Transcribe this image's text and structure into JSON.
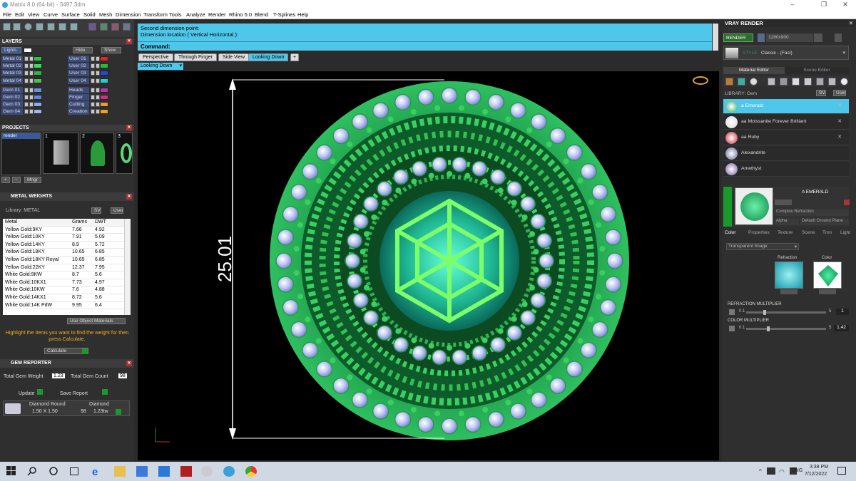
{
  "window": {
    "title": "Matrix 8.0 (64-bit) - 3497.3dm",
    "min": "–",
    "max": "❐",
    "close": "✕"
  },
  "menu": [
    "File",
    "Edit",
    "View",
    "Curve",
    "Surface",
    "Solid",
    "Mesh",
    "Dimension",
    "Transform",
    "Tools",
    "Analyze",
    "Render",
    "Rhino 5.0",
    "Blend",
    "T-Splines",
    "Help"
  ],
  "layers": {
    "title": "LAYERS",
    "lights_label": "Lights",
    "hide_label": "Hide",
    "show_label": "Show",
    "left": [
      {
        "name": "Metal 01",
        "color": "#2dc43a"
      },
      {
        "name": "Metal 02",
        "color": "#3fd860"
      },
      {
        "name": "Metal 03",
        "color": "#39b04a"
      },
      {
        "name": "Metal 04",
        "color": "#50c050"
      },
      {
        "name": "Gem 01",
        "color": "#6c8fe8"
      },
      {
        "name": "Gem 02",
        "color": "#5a8ae0"
      },
      {
        "name": "Gem 03",
        "color": "#88aaf0"
      },
      {
        "name": "Gem 04",
        "color": "#9ab8ee"
      }
    ],
    "right": [
      {
        "name": "User 01",
        "color": "#e0242c"
      },
      {
        "name": "User 02",
        "color": "#22c030"
      },
      {
        "name": "User 03",
        "color": "#2448e8"
      },
      {
        "name": "User 04",
        "color": "#20d0d8"
      },
      {
        "name": "Heads",
        "color": "#b03aa8"
      },
      {
        "name": "Finger",
        "color": "#d82a8a"
      },
      {
        "name": "Cutting",
        "color": "#e8a028"
      },
      {
        "name": "Creation",
        "color": "#f0a020"
      }
    ]
  },
  "projects": {
    "title": "PROJECTS",
    "item": "render",
    "thumbs": [
      "1",
      "2",
      "3"
    ],
    "mngr": "Mngr"
  },
  "metal_weights": {
    "title": "METAL WEIGHTS",
    "library_label": "Library: METAL",
    "sv": "SV",
    "user": "User",
    "columns": [
      "Metal",
      "Grams",
      "DWT"
    ],
    "rows": [
      [
        "Yellow Gold:9KY",
        "7.66",
        "4.92"
      ],
      [
        "Yellow Gold:10KY",
        "7.91",
        "5.09"
      ],
      [
        "Yellow Gold:14KY",
        "8.9",
        "5.72"
      ],
      [
        "Yellow Gold:18KY",
        "10.65",
        "6.85"
      ],
      [
        "Yellow Gold:18KY Royal",
        "10.65",
        "6.85"
      ],
      [
        "Yellow Gold:22KY",
        "12.37",
        "7.95"
      ],
      [
        "White Gold:9KW",
        "8.7",
        "5.6"
      ],
      [
        "White Gold:10KX1",
        "7.73",
        "4.97"
      ],
      [
        "White Gold:10KW",
        "7.6",
        "4.88"
      ],
      [
        "White Gold:14KX1",
        "8.72",
        "5.6"
      ],
      [
        "White Gold:14K PdW",
        "9.95",
        "6.4"
      ]
    ],
    "use_obj": "Use Object Materials",
    "hint": "Highlight the items you want to find the weight for then press Calculate.",
    "calc": "Calculate"
  },
  "gem_reporter": {
    "title": "GEM REPORTER",
    "total_weight_label": "Total Gem Weight",
    "total_weight": "1.23",
    "total_count_label": "Total Gem Count",
    "total_count": "98",
    "update": "Update",
    "save": "Save Report",
    "gem": {
      "shape": "Diamond Round",
      "size": "1.50 X 1.50",
      "type": "Diamond",
      "count": "98",
      "ctw": "1.23tw"
    }
  },
  "command": {
    "line1": "Second dimension point:",
    "line2": "Dimension location ( Vertical  Horizontal ):",
    "label": "Command:"
  },
  "view_tabs": [
    "Perspective",
    "Through Finger",
    "Side View",
    "Looking Down",
    "+"
  ],
  "view_dropdown": "Looking Down",
  "dimension": "25.01",
  "vray": {
    "title": "VRAY RENDER",
    "render": "RENDER",
    "resolution": "1280x900",
    "style_label": "STYLE",
    "style_value": "Classic - (Fast)",
    "tabs": [
      "Material Editor",
      "Scene Editor"
    ],
    "library_label": "LIBRARY: Gem",
    "sv": "SV",
    "user": "User",
    "materials": [
      {
        "name": "a Emerald",
        "color": "#1fa76a",
        "selected": true,
        "x": "✕"
      },
      {
        "name": "aa Moissanite Forever Brilliant",
        "color": "#d8d8d8",
        "x": "✕"
      },
      {
        "name": "aa Ruby",
        "color": "#c82838",
        "x": "✕"
      },
      {
        "name": "Alexandrite",
        "color": "#606890",
        "x": ""
      },
      {
        "name": "Amethyst",
        "color": "#7a5aa8",
        "x": ""
      }
    ],
    "preview_name": "A EMERALD",
    "mat_type": "Complex Refraction",
    "alpha": "Alpha",
    "ground": "Default Ground Plane",
    "subtabs": [
      "Color",
      "Properties",
      "Texture",
      "Scene",
      "Tron",
      "Light"
    ],
    "color_mode": "Transparent Image",
    "refraction_label": "Refraction",
    "color_label": "Color",
    "refr_mult_label": "REFRACTION MULTIPLIER",
    "refr_min": "0.1",
    "refr_max": "5",
    "refr_value": "1",
    "refr_fraction": 0.22,
    "color_mult_label": "COLOR MULTIPLIER",
    "col_min": "0.1",
    "col_max": "5",
    "col_value": "1.42",
    "col_fraction": 0.27
  },
  "taskbar": {
    "time": "3:38 PM",
    "date": "7/12/2022",
    "lang": "ENG"
  }
}
